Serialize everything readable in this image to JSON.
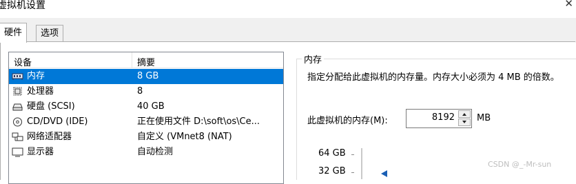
{
  "window": {
    "title": "虚拟机设置"
  },
  "tabs": [
    {
      "label": "硬件",
      "active": true
    },
    {
      "label": "选项",
      "active": false
    }
  ],
  "device_list": {
    "headers": [
      "设备",
      "摘要"
    ],
    "rows": [
      {
        "icon": "memory-icon",
        "device": "内存",
        "summary": "8 GB",
        "selected": true
      },
      {
        "icon": "processor-icon",
        "device": "处理器",
        "summary": "8"
      },
      {
        "icon": "hard-disk-icon",
        "device": "硬盘 (SCSI)",
        "summary": "40 GB"
      },
      {
        "icon": "cd-dvd-icon",
        "device": "CD/DVD (IDE)",
        "summary": "正在使用文件 D:\\soft\\os\\Ce..."
      },
      {
        "icon": "network-adapter-icon",
        "device": "网络适配器",
        "summary": "自定义 (VMnet8 (NAT)"
      },
      {
        "icon": "display-icon",
        "device": "显示器",
        "summary": "自动检测"
      }
    ]
  },
  "memory_panel": {
    "group_title": "内存",
    "description": "指定分配给此虚拟机的内存量。内存大小必须为 4 MB 的倍数。",
    "field_label": "此虚拟机的内存(M):",
    "value": "8192",
    "unit": "MB",
    "gauge_labels": [
      "64 GB",
      "32 GB"
    ]
  },
  "watermark": "CSDN @_-Mr-sun",
  "colors": {
    "selection": "#0078d7",
    "pointer": "#1a5fb4"
  }
}
